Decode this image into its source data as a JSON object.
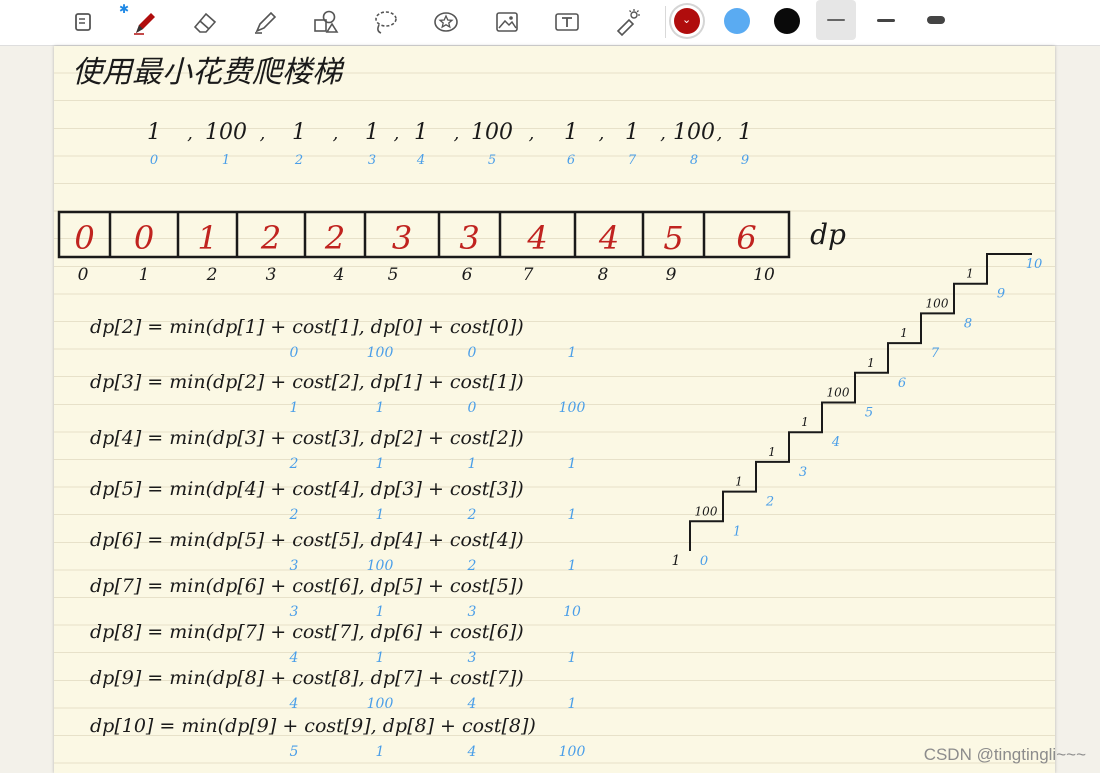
{
  "toolbar": {
    "tools": [
      {
        "name": "page-icon"
      },
      {
        "name": "pen-icon"
      },
      {
        "name": "eraser-icon"
      },
      {
        "name": "highlighter-icon"
      },
      {
        "name": "shapes-icon"
      },
      {
        "name": "lasso-icon"
      },
      {
        "name": "sticker-icon"
      },
      {
        "name": "image-icon"
      },
      {
        "name": "text-icon"
      },
      {
        "name": "laser-pointer-icon"
      }
    ],
    "bluetooth_icon": "bluetooth-icon",
    "colors": [
      "#b00d0d",
      "#5aabf2",
      "#0a0a0a"
    ],
    "stroke_widths": [
      "thin",
      "medium",
      "thick"
    ]
  },
  "note": {
    "title": "使用最小花费爬楼梯",
    "cost": {
      "values": [
        "1",
        "100",
        "1",
        "1",
        "1",
        "100",
        "1",
        "1",
        "100",
        "1"
      ],
      "indices": [
        "0",
        "1",
        "2",
        "3",
        "4",
        "5",
        "6",
        "7",
        "8",
        "9"
      ]
    },
    "dp": {
      "label": "dp",
      "values": [
        "0",
        "0",
        "1",
        "2",
        "2",
        "3",
        "3",
        "4",
        "4",
        "5",
        "6"
      ],
      "indices": [
        "0",
        "1",
        "2",
        "3",
        "4",
        "5",
        "6",
        "7",
        "8",
        "9",
        "10"
      ]
    },
    "formulas": [
      {
        "text": "dp[2] = min(dp[1] + cost[1], dp[0] + cost[0])",
        "subs": [
          "0",
          "100",
          "0",
          "1"
        ]
      },
      {
        "text": "dp[3] = min(dp[2] + cost[2], dp[1] + cost[1])",
        "subs": [
          "1",
          "1",
          "0",
          "100"
        ]
      },
      {
        "text": "dp[4] = min(dp[3] + cost[3], dp[2] + cost[2])",
        "subs": [
          "2",
          "1",
          "1",
          "1"
        ]
      },
      {
        "text": "dp[5] = min(dp[4] + cost[4], dp[3] + cost[3])",
        "subs": [
          "2",
          "1",
          "2",
          "1"
        ]
      },
      {
        "text": "dp[6] = min(dp[5] + cost[5], dp[4] + cost[4])",
        "subs": [
          "3",
          "100",
          "2",
          "1"
        ]
      },
      {
        "text": "dp[7] = min(dp[6] + cost[6], dp[5] + cost[5])",
        "subs": [
          "3",
          "1",
          "3",
          "10"
        ]
      },
      {
        "text": "dp[8] = min(dp[7] + cost[7], dp[6] + cost[6])",
        "subs": [
          "4",
          "1",
          "3",
          "1"
        ]
      },
      {
        "text": "dp[9] = min(dp[8] + cost[8], dp[7] + cost[7])",
        "subs": [
          "4",
          "100",
          "4",
          "1"
        ]
      },
      {
        "text": "dp[10] = min(dp[9] + cost[9], dp[8] + cost[8])",
        "subs": [
          "5",
          "1",
          "4",
          "100"
        ]
      }
    ],
    "stairs": {
      "costs": [
        "100",
        "1",
        "1",
        "1",
        "100",
        "1",
        "1",
        "100",
        "1"
      ],
      "steps": [
        "0",
        "1",
        "2",
        "3",
        "4",
        "5",
        "6",
        "7",
        "8",
        "9",
        "10"
      ],
      "start_cost": "1"
    }
  },
  "watermark": "CSDN @tingtingli~~~"
}
